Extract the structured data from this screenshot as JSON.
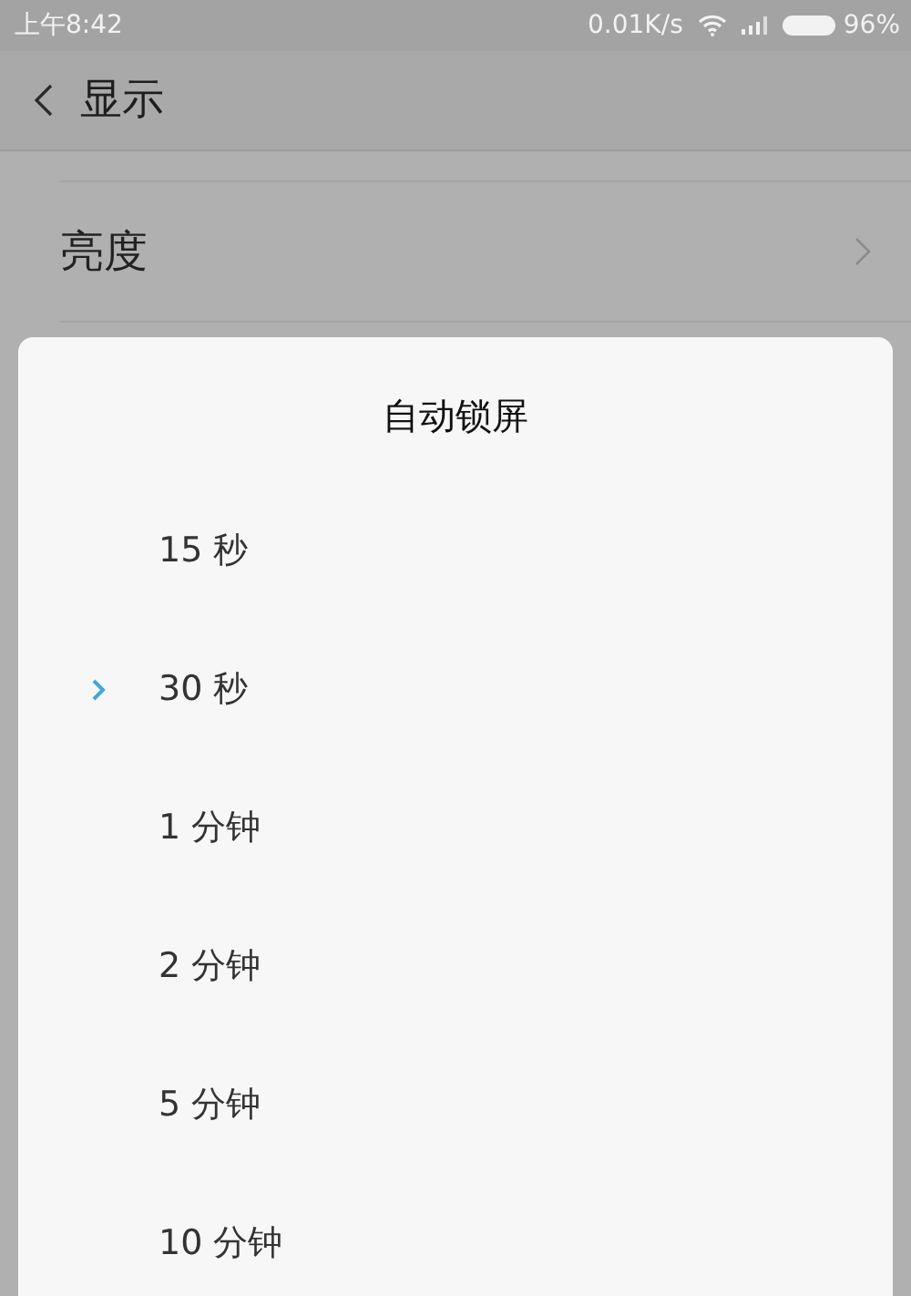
{
  "status_bar": {
    "time": "上午8:42",
    "net_speed": "0.01K/s",
    "battery": "96%"
  },
  "header": {
    "title": "显示"
  },
  "settings": [
    {
      "label": "亮度"
    }
  ],
  "dialog": {
    "title": "自动锁屏",
    "options": [
      {
        "label": "15 秒",
        "selected": false
      },
      {
        "label": "30 秒",
        "selected": true
      },
      {
        "label": "1 分钟",
        "selected": false
      },
      {
        "label": "2 分钟",
        "selected": false
      },
      {
        "label": "5 分钟",
        "selected": false
      },
      {
        "label": "10 分钟",
        "selected": false
      }
    ]
  }
}
